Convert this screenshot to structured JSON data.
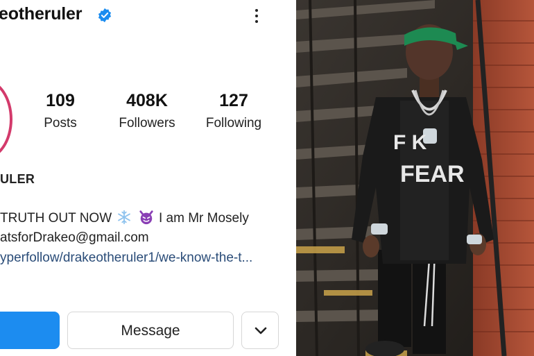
{
  "profile": {
    "username": "eotheruler",
    "fullname": "ULER",
    "stats": [
      {
        "value": "109",
        "label": "Posts"
      },
      {
        "value": "408K",
        "label": "Followers"
      },
      {
        "value": "127",
        "label": "Following"
      }
    ],
    "bio": {
      "line1_pre": "TRUTH OUT NOW",
      "line1_post": "I am Mr Mosely",
      "line2": "atsforDrakeo@gmail.com",
      "line3": "yperfollow/drakeotheruler1/we-know-the-t..."
    },
    "buttons": {
      "message": "Message"
    }
  },
  "photo": {
    "shirt_line1": "F  K",
    "shirt_line2": "FEAR"
  },
  "colors": {
    "verified": "#1a8cf0",
    "follow_button": "#1c8cf0",
    "link": "#2a4c78",
    "avatar_ring": "#d33a6b"
  },
  "icons": [
    "verified-badge-icon",
    "more-options-icon",
    "snowflake-emoji",
    "devil-emoji",
    "chevron-down-icon"
  ]
}
